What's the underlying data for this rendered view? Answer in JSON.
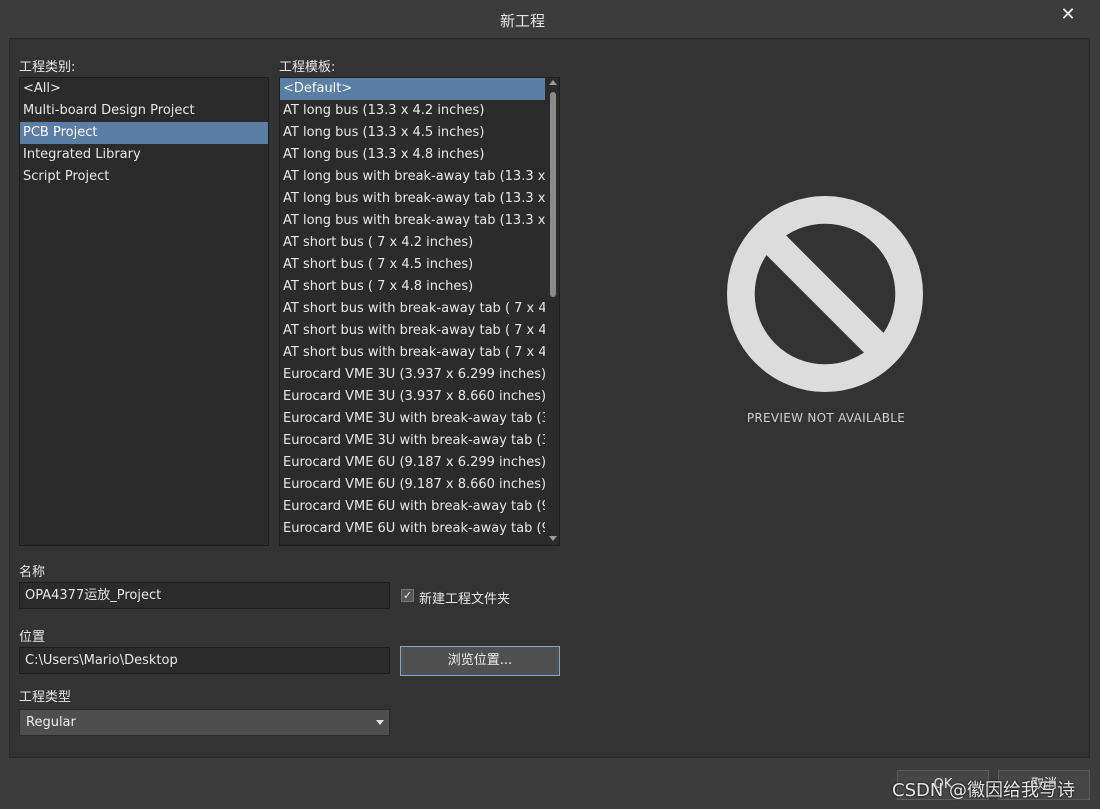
{
  "window": {
    "title": "新工程",
    "close_glyph": "✕"
  },
  "categories": {
    "label": "工程类别:",
    "items": [
      "<All>",
      "Multi-board Design Project",
      "PCB Project",
      "Integrated Library",
      "Script Project"
    ],
    "selected": "PCB Project"
  },
  "templates": {
    "label": "工程模板:",
    "items": [
      "<Default>",
      "AT long bus (13.3 x 4.2 inches)",
      "AT long bus (13.3 x 4.5 inches)",
      "AT long bus (13.3 x 4.8 inches)",
      "AT long bus with break-away tab (13.3 x 4.",
      "AT long bus with break-away tab (13.3 x 4.",
      "AT long bus with break-away tab (13.3 x 4.",
      "AT short bus ( 7 x 4.2 inches)",
      "AT short bus ( 7 x 4.5 inches)",
      "AT short bus ( 7 x 4.8 inches)",
      "AT short bus with break-away tab ( 7 x 4.2",
      "AT short bus with break-away tab ( 7 x 4.5",
      "AT short bus with break-away tab ( 7 x 4.8",
      "Eurocard VME 3U (3.937 x 6.299 inches)",
      "Eurocard VME 3U (3.937 x 8.660 inches)",
      "Eurocard VME 3U with break-away tab (3.9",
      "Eurocard VME 3U with break-away tab (3.9",
      "Eurocard VME 6U (9.187 x 6.299 inches)",
      "Eurocard VME 6U (9.187 x 8.660 inches)",
      "Eurocard VME 6U with break-away tab (9.1",
      "Eurocard VME 6U with break-away tab (9.1"
    ],
    "selected": "<Default>"
  },
  "preview": {
    "text": "PREVIEW NOT AVAILABLE",
    "icon": "prohibited-icon"
  },
  "name": {
    "label": "名称",
    "value": "OPA4377运放_Project"
  },
  "new_folder": {
    "label": "新建工程文件夹",
    "checked": true,
    "check_glyph": "✓"
  },
  "location": {
    "label": "位置",
    "value": "C:\\Users\\Mario\\Desktop",
    "browse_label": "浏览位置..."
  },
  "project_type": {
    "label": "工程类型",
    "value": "Regular"
  },
  "buttons": {
    "ok": "OK",
    "cancel": "取消"
  },
  "watermark": "CSDN @徽因给我写诗"
}
